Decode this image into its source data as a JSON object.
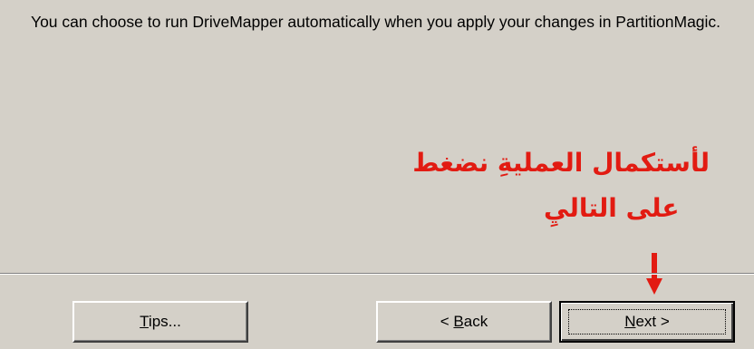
{
  "wizard": {
    "description": "You can choose to run DriveMapper automatically when you apply your changes in PartitionMagic."
  },
  "annotation": {
    "line1": "لأستكمال العمليةِ نضغط",
    "line2": "على التاليِ",
    "color": "#e21b12",
    "arrow_icon": "down-arrow"
  },
  "buttons": {
    "tips": {
      "mnemonic": "T",
      "rest": "ips..."
    },
    "back": {
      "prefix": "< ",
      "mnemonic": "B",
      "rest": "ack"
    },
    "next": {
      "mnemonic": "N",
      "rest": "ext >"
    }
  }
}
